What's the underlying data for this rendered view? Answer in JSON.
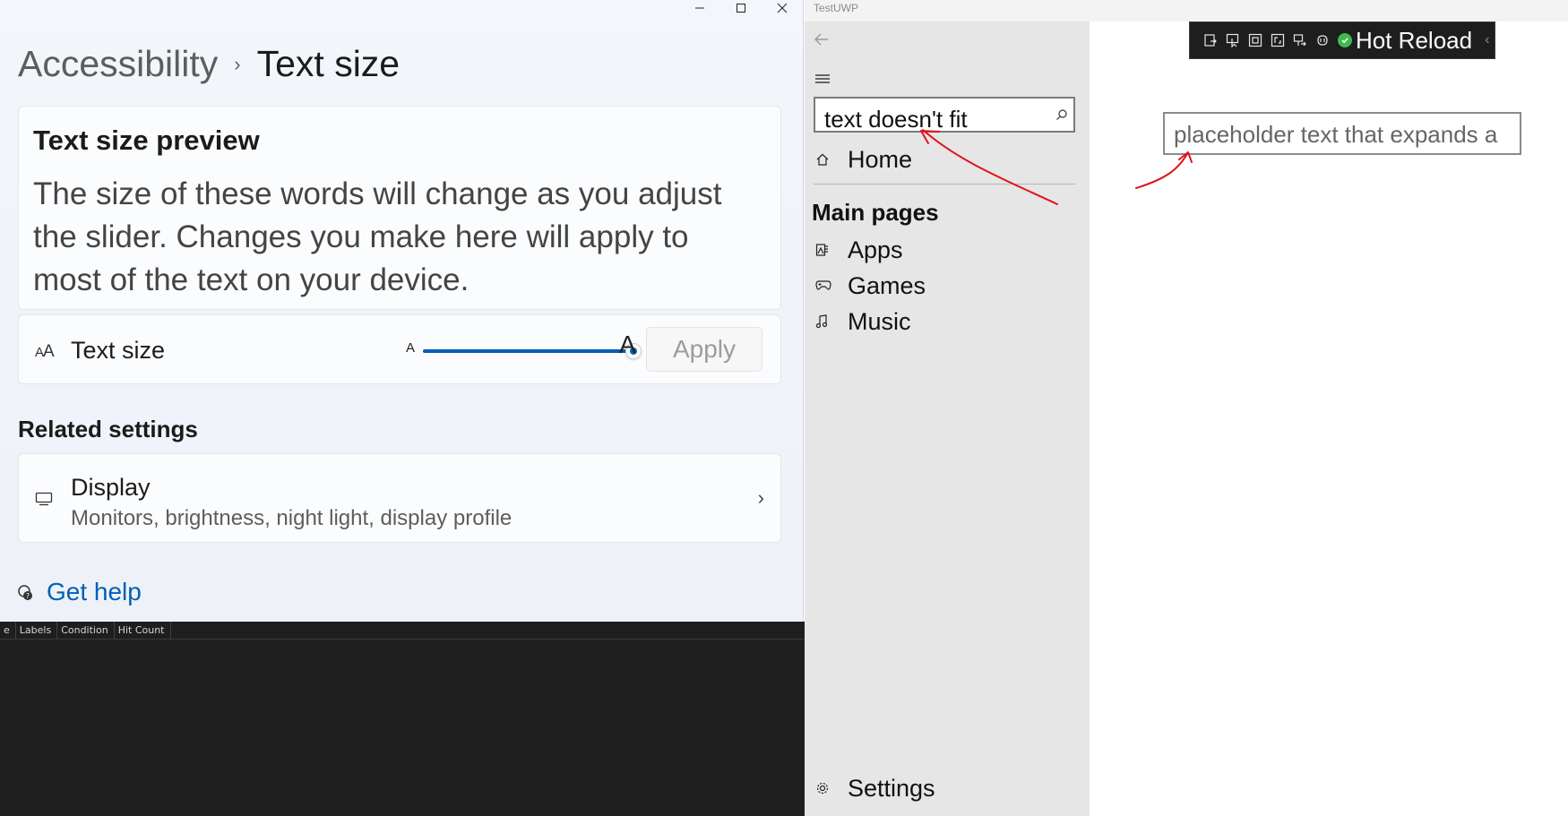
{
  "settings": {
    "breadcrumb": {
      "parent": "Accessibility",
      "separator": "›",
      "current": "Text size"
    },
    "preview": {
      "title": "Text size preview",
      "body": "The size of these words will change as you adjust the slider. Changes you make here will apply to most of the text on your device."
    },
    "text_size": {
      "label": "Text size",
      "icon": "text-size-icon",
      "slider_small_label": "A",
      "slider_large_label": "A",
      "slider_value": 1.0,
      "apply_label": "Apply"
    },
    "related": {
      "title": "Related settings",
      "display": {
        "label": "Display",
        "description": "Monitors, brightness, night light, display profile",
        "icon": "monitor-icon"
      }
    },
    "help": {
      "label": "Get help",
      "icon": "help-icon"
    },
    "colors": {
      "accent": "#005fb8",
      "link": "#005fb8",
      "background": "#f3f6fb",
      "card": "#fbfcfe"
    }
  },
  "tool_window": {
    "columns": [
      "e",
      "Labels",
      "Condition",
      "Hit Count"
    ],
    "background": "#1e1e1e"
  },
  "uwp": {
    "title": "TestUWP",
    "search": {
      "value": "text doesn't fit",
      "icon": "search-icon"
    },
    "nav": {
      "home": "Home",
      "section": "Main pages",
      "items": [
        {
          "label": "Apps",
          "icon": "apps-icon"
        },
        {
          "label": "Games",
          "icon": "gamepad-icon"
        },
        {
          "label": "Music",
          "icon": "music-note-icon"
        }
      ],
      "settings": "Settings"
    },
    "hot_reload": {
      "label": "Hot Reload",
      "status": "check-circle-icon",
      "expander": "‹"
    },
    "textbox": {
      "placeholder": "placeholder text that expands a"
    },
    "annotation_color": "#e0141c"
  }
}
